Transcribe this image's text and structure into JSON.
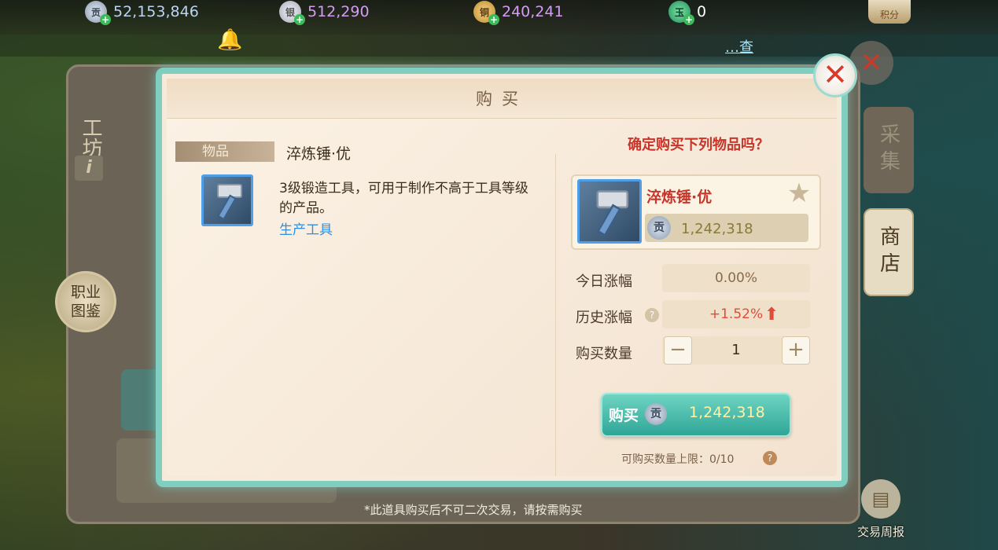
{
  "resources": [
    {
      "icon": "contribution-coin-icon",
      "icon_glyph": "贡",
      "value": "52,153,846",
      "color": "#bcd3f2"
    },
    {
      "icon": "silver-ingot-icon",
      "icon_glyph": "银",
      "value": "512,290",
      "color": "#d59cf5"
    },
    {
      "icon": "copper-coin-icon",
      "icon_glyph": "铜",
      "value": "240,241",
      "color": "#d59cf5"
    },
    {
      "icon": "jade-coin-icon",
      "icon_glyph": "玉",
      "value": "0",
      "color": "#ffffff"
    }
  ],
  "score_badge": "积分",
  "more_link": "…查",
  "bg": {
    "left_tab": "工坊",
    "info": "i",
    "career_book": "职业图鉴",
    "tab_gather": "采集",
    "tab_shop": "商店",
    "weekly_report": "交易周报",
    "footer_note": "*此道具购买后不可二次交易，请按需购买"
  },
  "modal": {
    "title": "购买",
    "close": "✕",
    "item_tag": "物品",
    "item_name": "淬炼锤·优",
    "item_desc": "3级锻造工具，可用于制作不高于工具等级的产品。",
    "item_category": "生产工具",
    "confirm_question": "确定购买下列物品吗？",
    "card_name": "淬炼锤·优",
    "card_price": "1,242,318",
    "contrib_glyph": "贡",
    "today_label": "今日涨幅",
    "today_value": "0.00%",
    "history_label": "历史涨幅",
    "history_value": "+1.52%",
    "qty_label": "购买数量",
    "qty_minus": "−",
    "qty_value": "1",
    "qty_plus": "+",
    "buy_label": "购买",
    "buy_price": "1,242,318",
    "limit_text": "可购买数量上限：0/10",
    "help": "?"
  },
  "colors": {
    "accent_teal": "#2fa697",
    "price_red": "#c8352a",
    "rise_red": "#e24a3a",
    "category_blue": "#2f8fe0"
  }
}
